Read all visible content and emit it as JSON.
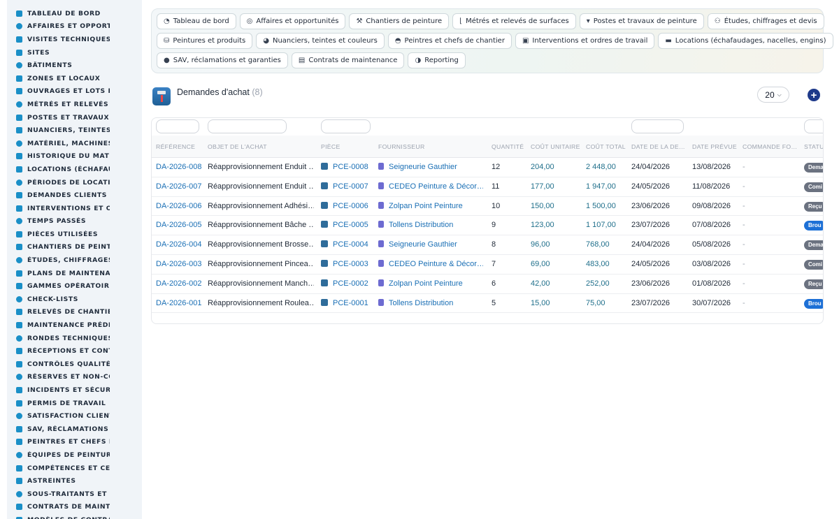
{
  "sidebar": {
    "items": [
      {
        "label": "TABLEAU DE BORD",
        "icon": "dashboard-icon"
      },
      {
        "label": "AFFAIRES ET OPPORTUNITÉS",
        "icon": "target-icon"
      },
      {
        "label": "VISITES TECHNIQUES ET",
        "icon": "clipboard-icon"
      },
      {
        "label": "SITES",
        "icon": "location-pin-icon"
      },
      {
        "label": "BÂTIMENTS",
        "icon": "building-icon"
      },
      {
        "label": "ZONES ET LOCAUX",
        "icon": "grid-icon"
      },
      {
        "label": "OUVRAGES ET LOTS DE TRAVAUX",
        "icon": "hierarchy-icon"
      },
      {
        "label": "MÉTRÉS ET RELEVÉS DE",
        "icon": "ruler-icon"
      },
      {
        "label": "POSTES ET TRAVAUX DE",
        "icon": "paint-roller-icon"
      },
      {
        "label": "NUANCIERS, TEINTES ET",
        "icon": "palette-icon"
      },
      {
        "label": "MATÉRIEL, MACHINES ET",
        "icon": "tools-icon"
      },
      {
        "label": "HISTORIQUE DU MATÉRIEL",
        "icon": "book-icon"
      },
      {
        "label": "LOCATIONS (ÉCHAFAUDAGES",
        "icon": "truck-icon"
      },
      {
        "label": "PÉRIODES DE LOCATION",
        "icon": "calendar-icon"
      },
      {
        "label": "DEMANDES CLIENTS ET I",
        "icon": "question-icon"
      },
      {
        "label": "INTERVENTIONS ET ORDRES",
        "icon": "clipboard-check-icon"
      },
      {
        "label": "TEMPS PASSÉS",
        "icon": "clock-icon"
      },
      {
        "label": "PIÈCES UTILISÉES",
        "icon": "box-icon"
      },
      {
        "label": "CHANTIERS DE PEINTURE",
        "icon": "hammer-icon"
      },
      {
        "label": "ÉTUDES, CHIFFRAGES ET",
        "icon": "people-icon"
      },
      {
        "label": "PLANS DE MAINTENANCE",
        "icon": "document-icon"
      },
      {
        "label": "GAMMES OPÉRATOIRES",
        "icon": "list-icon"
      },
      {
        "label": "CHECK-LISTS",
        "icon": "checklist-icon"
      },
      {
        "label": "RELEVÉS DE CHANTIER",
        "icon": "clipboard-icon"
      },
      {
        "label": "MAINTENANCE PRÉDICTIVE",
        "icon": "chart-icon"
      },
      {
        "label": "RONDES TECHNIQUES",
        "icon": "route-icon"
      },
      {
        "label": "RÉCEPTIONS ET CONTRÔLES",
        "icon": "search-icon"
      },
      {
        "label": "CONTRÔLES QUALITÉ ET",
        "icon": "clipboard-icon"
      },
      {
        "label": "RÉSERVES ET NON-CONFORMITÉS",
        "icon": "alert-icon"
      },
      {
        "label": "INCIDENTS ET SÉCURITÉ",
        "icon": "warning-icon"
      },
      {
        "label": "PERMIS DE TRAVAIL",
        "icon": "pen-icon"
      },
      {
        "label": "SATISFACTION CLIENT",
        "icon": "smile-icon"
      },
      {
        "label": "SAV, RÉCLAMATIONS ET G",
        "icon": "chat-icon"
      },
      {
        "label": "PEINTRES ET CHEFS DE C",
        "icon": "helmet-icon"
      },
      {
        "label": "ÉQUIPES DE PEINTURE",
        "icon": "team-icon"
      },
      {
        "label": "COMPÉTENCES ET CERTIFICATIONS",
        "icon": "badge-icon"
      },
      {
        "label": "ASTREINTES",
        "icon": "phone-icon"
      },
      {
        "label": "SOUS-TRAITANTS ET FOURNISSEURS",
        "icon": "handshake-icon"
      },
      {
        "label": "CONTRATS DE MAINTENANCE",
        "icon": "file-icon"
      },
      {
        "label": "MODÈLES DE CONTRATS",
        "icon": "file-icon"
      }
    ]
  },
  "topnav": {
    "rows": [
      [
        {
          "label": "Tableau de bord",
          "icon": "dashboard-icon",
          "glyph": "◔"
        },
        {
          "label": "Affaires et opportunités",
          "icon": "target-icon",
          "glyph": "◎"
        },
        {
          "label": "Chantiers de peinture",
          "icon": "hammer-icon",
          "glyph": "⚒"
        },
        {
          "label": "Métrés et relevés de surfaces",
          "icon": "ruler-icon",
          "glyph": "⌊"
        },
        {
          "label": "Postes et travaux de peinture",
          "icon": "paint-roller-icon",
          "glyph": "▾"
        },
        {
          "label": "Études, chiffrages et devis",
          "icon": "people-icon",
          "glyph": "⚇"
        }
      ],
      [
        {
          "label": "Peintures et produits",
          "icon": "paint-bucket-icon",
          "glyph": "⛁"
        },
        {
          "label": "Nuanciers, teintes et couleurs",
          "icon": "palette-icon",
          "glyph": "◕"
        },
        {
          "label": "Peintres et chefs de chantier",
          "icon": "helmet-icon",
          "glyph": "◓"
        },
        {
          "label": "Interventions et ordres de travail",
          "icon": "clipboard-icon",
          "glyph": "▣"
        },
        {
          "label": "Locations (échafaudages, nacelles, engins)",
          "icon": "truck-icon",
          "glyph": "▬"
        }
      ],
      [
        {
          "label": "SAV, réclamations et garanties",
          "icon": "chat-icon",
          "glyph": "●"
        },
        {
          "label": "Contrats de maintenance",
          "icon": "file-icon",
          "glyph": "▤"
        },
        {
          "label": "Reporting",
          "icon": "pie-chart-icon",
          "glyph": "◑"
        }
      ]
    ]
  },
  "header": {
    "title": "Demandes d'achat",
    "count": "(8)",
    "per_page": "20",
    "add_glyph": "+"
  },
  "table": {
    "columns": {
      "reference": "RÉFÉRENCE",
      "objet": "OBJET DE L'ACHAT",
      "piece": "PIÈCE",
      "fournisseur": "FOURNISSEUR",
      "quantite": "QUANTITÉ",
      "cout_unitaire": "COÛT UNITAIRE",
      "cout_total": "COÛT TOTAL",
      "date_demande": "DATE DE LA DE…",
      "date_prevue": "DATE PRÉVUE",
      "commande": "COMMANDE FO…",
      "statut": "STATU"
    },
    "rows": [
      {
        "reference": "DA-2026-008",
        "objet": "Réapprovisionnement Enduit …",
        "piece": "PCE-0008",
        "fournisseur": "Seigneurie Gauthier",
        "quantite": "12",
        "cout_unitaire": "204,00",
        "cout_total": "2 448,00",
        "date_demande": "24/04/2026",
        "date_prevue": "13/08/2026",
        "commande": "-",
        "statut": "Dema",
        "statut_color": "#6b7280"
      },
      {
        "reference": "DA-2026-007",
        "objet": "Réapprovisionnement Enduit …",
        "piece": "PCE-0007",
        "fournisseur": "CEDEO Peinture & Décor…",
        "quantite": "11",
        "cout_unitaire": "177,00",
        "cout_total": "1 947,00",
        "date_demande": "24/05/2026",
        "date_prevue": "11/08/2026",
        "commande": "-",
        "statut": "Comi",
        "statut_color": "#6b7280"
      },
      {
        "reference": "DA-2026-006",
        "objet": "Réapprovisionnement Adhési…",
        "piece": "PCE-0006",
        "fournisseur": "Zolpan Point Peinture",
        "quantite": "10",
        "cout_unitaire": "150,00",
        "cout_total": "1 500,00",
        "date_demande": "23/06/2026",
        "date_prevue": "09/08/2026",
        "commande": "-",
        "statut": "Reçu",
        "statut_color": "#6b7280"
      },
      {
        "reference": "DA-2026-005",
        "objet": "Réapprovisionnement Bâche …",
        "piece": "PCE-0005",
        "fournisseur": "Tollens Distribution",
        "quantite": "9",
        "cout_unitaire": "123,00",
        "cout_total": "1 107,00",
        "date_demande": "23/07/2026",
        "date_prevue": "07/08/2026",
        "commande": "-",
        "statut": "Brou",
        "statut_color": "#1d70d6"
      },
      {
        "reference": "DA-2026-004",
        "objet": "Réapprovisionnement Brosse…",
        "piece": "PCE-0004",
        "fournisseur": "Seigneurie Gauthier",
        "quantite": "8",
        "cout_unitaire": "96,00",
        "cout_total": "768,00",
        "date_demande": "24/04/2026",
        "date_prevue": "05/08/2026",
        "commande": "-",
        "statut": "Dema",
        "statut_color": "#6b7280"
      },
      {
        "reference": "DA-2026-003",
        "objet": "Réapprovisionnement Pincea…",
        "piece": "PCE-0003",
        "fournisseur": "CEDEO Peinture & Décor…",
        "quantite": "7",
        "cout_unitaire": "69,00",
        "cout_total": "483,00",
        "date_demande": "24/05/2026",
        "date_prevue": "03/08/2026",
        "commande": "-",
        "statut": "Comi",
        "statut_color": "#6b7280"
      },
      {
        "reference": "DA-2026-002",
        "objet": "Réapprovisionnement Manch…",
        "piece": "PCE-0002",
        "fournisseur": "Zolpan Point Peinture",
        "quantite": "6",
        "cout_unitaire": "42,00",
        "cout_total": "252,00",
        "date_demande": "23/06/2026",
        "date_prevue": "01/08/2026",
        "commande": "-",
        "statut": "Reçu",
        "statut_color": "#6b7280"
      },
      {
        "reference": "DA-2026-001",
        "objet": "Réapprovisionnement Roulea…",
        "piece": "PCE-0001",
        "fournisseur": "Tollens Distribution",
        "quantite": "5",
        "cout_unitaire": "15,00",
        "cout_total": "75,00",
        "date_demande": "23/07/2026",
        "date_prevue": "30/07/2026",
        "commande": "-",
        "statut": "Brou",
        "statut_color": "#1d70d6"
      }
    ]
  }
}
